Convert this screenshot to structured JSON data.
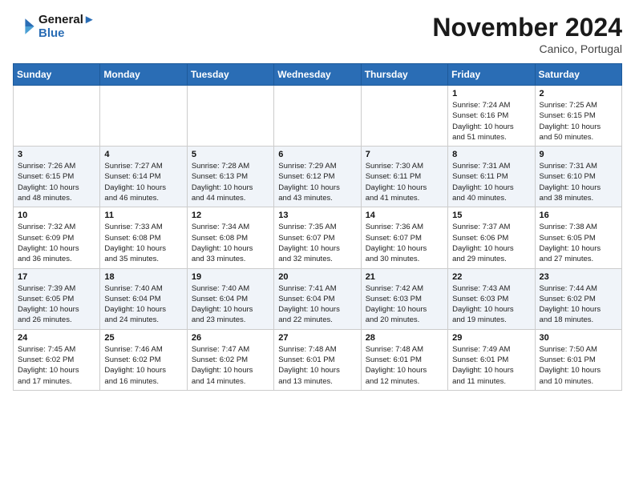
{
  "header": {
    "logo_line1": "General",
    "logo_line2": "Blue",
    "month": "November 2024",
    "location": "Canico, Portugal"
  },
  "days_of_week": [
    "Sunday",
    "Monday",
    "Tuesday",
    "Wednesday",
    "Thursday",
    "Friday",
    "Saturday"
  ],
  "weeks": [
    [
      {
        "day": "",
        "info": ""
      },
      {
        "day": "",
        "info": ""
      },
      {
        "day": "",
        "info": ""
      },
      {
        "day": "",
        "info": ""
      },
      {
        "day": "",
        "info": ""
      },
      {
        "day": "1",
        "info": "Sunrise: 7:24 AM\nSunset: 6:16 PM\nDaylight: 10 hours\nand 51 minutes."
      },
      {
        "day": "2",
        "info": "Sunrise: 7:25 AM\nSunset: 6:15 PM\nDaylight: 10 hours\nand 50 minutes."
      }
    ],
    [
      {
        "day": "3",
        "info": "Sunrise: 7:26 AM\nSunset: 6:15 PM\nDaylight: 10 hours\nand 48 minutes."
      },
      {
        "day": "4",
        "info": "Sunrise: 7:27 AM\nSunset: 6:14 PM\nDaylight: 10 hours\nand 46 minutes."
      },
      {
        "day": "5",
        "info": "Sunrise: 7:28 AM\nSunset: 6:13 PM\nDaylight: 10 hours\nand 44 minutes."
      },
      {
        "day": "6",
        "info": "Sunrise: 7:29 AM\nSunset: 6:12 PM\nDaylight: 10 hours\nand 43 minutes."
      },
      {
        "day": "7",
        "info": "Sunrise: 7:30 AM\nSunset: 6:11 PM\nDaylight: 10 hours\nand 41 minutes."
      },
      {
        "day": "8",
        "info": "Sunrise: 7:31 AM\nSunset: 6:11 PM\nDaylight: 10 hours\nand 40 minutes."
      },
      {
        "day": "9",
        "info": "Sunrise: 7:31 AM\nSunset: 6:10 PM\nDaylight: 10 hours\nand 38 minutes."
      }
    ],
    [
      {
        "day": "10",
        "info": "Sunrise: 7:32 AM\nSunset: 6:09 PM\nDaylight: 10 hours\nand 36 minutes."
      },
      {
        "day": "11",
        "info": "Sunrise: 7:33 AM\nSunset: 6:08 PM\nDaylight: 10 hours\nand 35 minutes."
      },
      {
        "day": "12",
        "info": "Sunrise: 7:34 AM\nSunset: 6:08 PM\nDaylight: 10 hours\nand 33 minutes."
      },
      {
        "day": "13",
        "info": "Sunrise: 7:35 AM\nSunset: 6:07 PM\nDaylight: 10 hours\nand 32 minutes."
      },
      {
        "day": "14",
        "info": "Sunrise: 7:36 AM\nSunset: 6:07 PM\nDaylight: 10 hours\nand 30 minutes."
      },
      {
        "day": "15",
        "info": "Sunrise: 7:37 AM\nSunset: 6:06 PM\nDaylight: 10 hours\nand 29 minutes."
      },
      {
        "day": "16",
        "info": "Sunrise: 7:38 AM\nSunset: 6:05 PM\nDaylight: 10 hours\nand 27 minutes."
      }
    ],
    [
      {
        "day": "17",
        "info": "Sunrise: 7:39 AM\nSunset: 6:05 PM\nDaylight: 10 hours\nand 26 minutes."
      },
      {
        "day": "18",
        "info": "Sunrise: 7:40 AM\nSunset: 6:04 PM\nDaylight: 10 hours\nand 24 minutes."
      },
      {
        "day": "19",
        "info": "Sunrise: 7:40 AM\nSunset: 6:04 PM\nDaylight: 10 hours\nand 23 minutes."
      },
      {
        "day": "20",
        "info": "Sunrise: 7:41 AM\nSunset: 6:04 PM\nDaylight: 10 hours\nand 22 minutes."
      },
      {
        "day": "21",
        "info": "Sunrise: 7:42 AM\nSunset: 6:03 PM\nDaylight: 10 hours\nand 20 minutes."
      },
      {
        "day": "22",
        "info": "Sunrise: 7:43 AM\nSunset: 6:03 PM\nDaylight: 10 hours\nand 19 minutes."
      },
      {
        "day": "23",
        "info": "Sunrise: 7:44 AM\nSunset: 6:02 PM\nDaylight: 10 hours\nand 18 minutes."
      }
    ],
    [
      {
        "day": "24",
        "info": "Sunrise: 7:45 AM\nSunset: 6:02 PM\nDaylight: 10 hours\nand 17 minutes."
      },
      {
        "day": "25",
        "info": "Sunrise: 7:46 AM\nSunset: 6:02 PM\nDaylight: 10 hours\nand 16 minutes."
      },
      {
        "day": "26",
        "info": "Sunrise: 7:47 AM\nSunset: 6:02 PM\nDaylight: 10 hours\nand 14 minutes."
      },
      {
        "day": "27",
        "info": "Sunrise: 7:48 AM\nSunset: 6:01 PM\nDaylight: 10 hours\nand 13 minutes."
      },
      {
        "day": "28",
        "info": "Sunrise: 7:48 AM\nSunset: 6:01 PM\nDaylight: 10 hours\nand 12 minutes."
      },
      {
        "day": "29",
        "info": "Sunrise: 7:49 AM\nSunset: 6:01 PM\nDaylight: 10 hours\nand 11 minutes."
      },
      {
        "day": "30",
        "info": "Sunrise: 7:50 AM\nSunset: 6:01 PM\nDaylight: 10 hours\nand 10 minutes."
      }
    ]
  ]
}
